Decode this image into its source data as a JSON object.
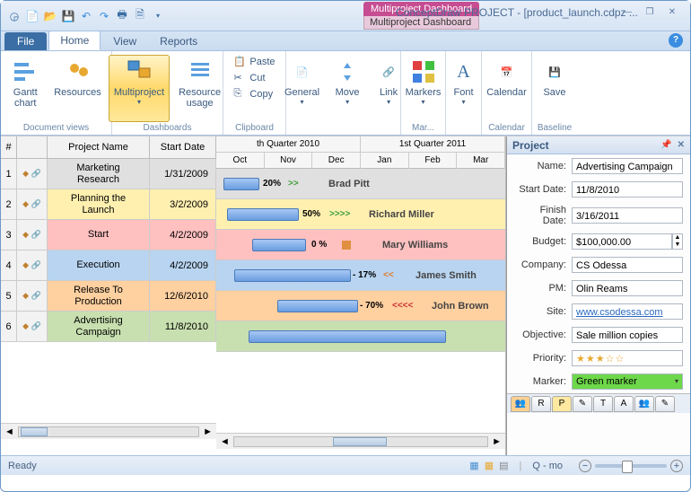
{
  "titlebar": {
    "context_parent": "Multiproject Dashboard",
    "context_child": "Multiproject Dashboard",
    "app_title": "ConceptDraw PROJECT - [product_launch.cdpz ..."
  },
  "tabs": {
    "file": "File",
    "home": "Home",
    "view": "View",
    "reports": "Reports"
  },
  "ribbon": {
    "gantt": "Gantt\nchart",
    "resources": "Resources",
    "multiproject": "Multiproject",
    "resource_usage": "Resource\nusage",
    "paste": "Paste",
    "cut": "Cut",
    "copy": "Copy",
    "general": "General",
    "move": "Move",
    "link": "Link",
    "markers": "Markers",
    "font": "Font",
    "calendar": "Calendar",
    "save": "Save",
    "g_docviews": "Document views",
    "g_dashboards": "Dashboards",
    "g_clipboard": "Clipboard",
    "g_mar": "Mar...",
    "g_calendar": "Calendar",
    "g_baseline": "Baseline"
  },
  "grid": {
    "h_num": "#",
    "h_name": "Project Name",
    "h_start": "Start Date",
    "rows": [
      {
        "num": "1",
        "name": "Marketing Research",
        "date": "1/31/2009",
        "cls": "r1"
      },
      {
        "num": "2",
        "name": "Planning the Launch",
        "date": "3/2/2009",
        "cls": "r2"
      },
      {
        "num": "3",
        "name": "Start",
        "date": "4/2/2009",
        "cls": "r3"
      },
      {
        "num": "4",
        "name": "Execution",
        "date": "4/2/2009",
        "cls": "r4"
      },
      {
        "num": "5",
        "name": "Release To Production",
        "date": "12/6/2010",
        "cls": "r5"
      },
      {
        "num": "6",
        "name": "Advertising Campaign",
        "date": "11/8/2010",
        "cls": "r6"
      }
    ]
  },
  "timeline": {
    "q4": "th Quarter 2010",
    "q1": "1st Quarter 2011",
    "months": [
      "Oct",
      "Nov",
      "Dec",
      "Jan",
      "Feb",
      "Mar"
    ],
    "rows": [
      {
        "pct": "20%",
        "arrows": ">>",
        "acls": "g",
        "name": "Brad Pitt"
      },
      {
        "pct": "50%",
        "arrows": ">>>>",
        "acls": "g",
        "name": "Richard Miller"
      },
      {
        "pct": "0 %",
        "arrows": "",
        "acls": "o",
        "sq": true,
        "name": "Mary Williams"
      },
      {
        "pct": "- 17%",
        "arrows": "<<",
        "acls": "o",
        "name": "James Smith"
      },
      {
        "pct": "- 70%",
        "arrows": "<<<<",
        "acls": "r",
        "name": "John Brown"
      },
      {
        "pct": "",
        "arrows": "",
        "acls": "",
        "name": ""
      }
    ]
  },
  "sidepane": {
    "title": "Project",
    "l_name": "Name:",
    "v_name": "Advertising Campaign",
    "l_start": "Start Date:",
    "v_start": "11/8/2010",
    "l_finish": "Finish Date:",
    "v_finish": "3/16/2011",
    "l_budget": "Budget:",
    "v_budget": "$100,000.00",
    "l_company": "Company:",
    "v_company": "CS Odessa",
    "l_pm": "PM:",
    "v_pm": "Olin Reams",
    "l_site": "Site:",
    "v_site": "www.csodessa.com",
    "l_obj": "Objective:",
    "v_obj": "Sale million copies",
    "l_priority": "Priority:",
    "l_marker": "Marker:",
    "v_marker": "Green marker"
  },
  "statusbar": {
    "ready": "Ready",
    "zoom_label": "Q - mo"
  }
}
